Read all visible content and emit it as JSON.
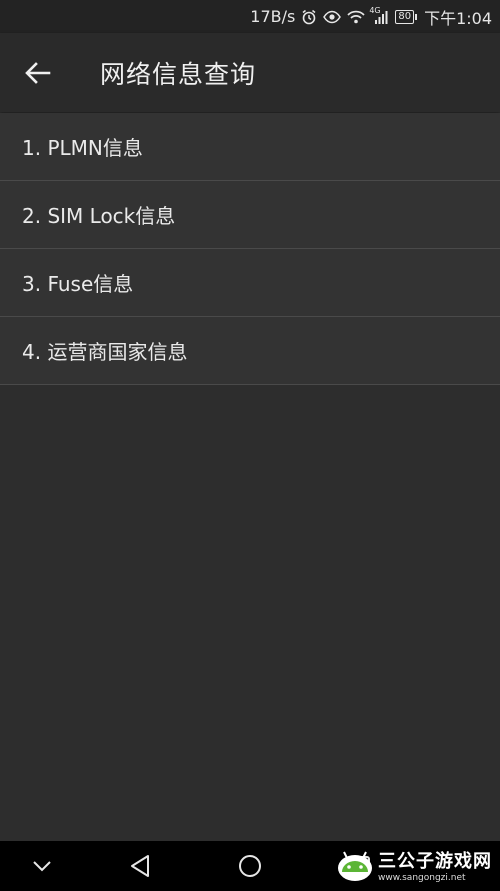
{
  "status_bar": {
    "speed": "17B/s",
    "network": "4G",
    "battery": "80",
    "time": "下午1:04"
  },
  "app_bar": {
    "title": "网络信息查询",
    "back_icon": "arrow-back-icon"
  },
  "menu": {
    "items": [
      {
        "label": "1. PLMN信息"
      },
      {
        "label": "2. SIM Lock信息"
      },
      {
        "label": "3. Fuse信息"
      },
      {
        "label": "4. 运营商国家信息"
      }
    ]
  },
  "nav_bar": {
    "icons": [
      "chevron-down-icon",
      "back-triangle-icon",
      "home-circle-icon",
      "recents-square-icon"
    ]
  },
  "watermark": {
    "name": "三公子游戏网",
    "url": "www.sangongzi.net"
  },
  "colors": {
    "background": "#2d2d2d",
    "app_bar": "#2a2a2a",
    "status_bar": "#232323",
    "nav_bar": "#000000",
    "divider": "#4a4a4a",
    "watermark_green": "#5bb535"
  }
}
